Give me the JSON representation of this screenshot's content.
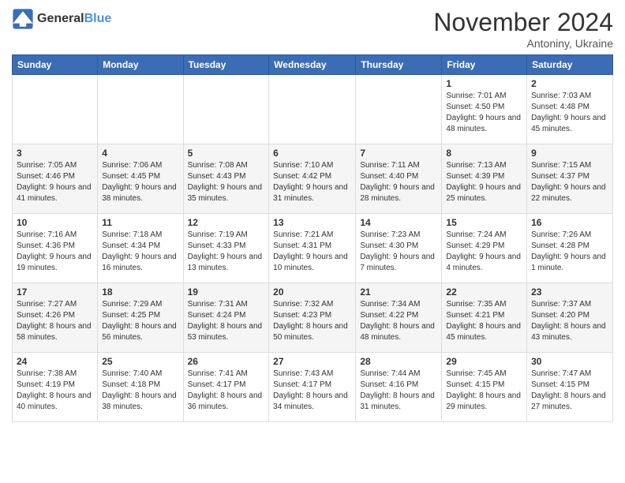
{
  "header": {
    "logo_general": "General",
    "logo_blue": "Blue",
    "month": "November 2024",
    "location": "Antoniny, Ukraine"
  },
  "weekdays": [
    "Sunday",
    "Monday",
    "Tuesday",
    "Wednesday",
    "Thursday",
    "Friday",
    "Saturday"
  ],
  "weeks": [
    [
      {
        "day": "",
        "info": ""
      },
      {
        "day": "",
        "info": ""
      },
      {
        "day": "",
        "info": ""
      },
      {
        "day": "",
        "info": ""
      },
      {
        "day": "",
        "info": ""
      },
      {
        "day": "1",
        "info": "Sunrise: 7:01 AM\nSunset: 4:50 PM\nDaylight: 9 hours and 48 minutes."
      },
      {
        "day": "2",
        "info": "Sunrise: 7:03 AM\nSunset: 4:48 PM\nDaylight: 9 hours and 45 minutes."
      }
    ],
    [
      {
        "day": "3",
        "info": "Sunrise: 7:05 AM\nSunset: 4:46 PM\nDaylight: 9 hours and 41 minutes."
      },
      {
        "day": "4",
        "info": "Sunrise: 7:06 AM\nSunset: 4:45 PM\nDaylight: 9 hours and 38 minutes."
      },
      {
        "day": "5",
        "info": "Sunrise: 7:08 AM\nSunset: 4:43 PM\nDaylight: 9 hours and 35 minutes."
      },
      {
        "day": "6",
        "info": "Sunrise: 7:10 AM\nSunset: 4:42 PM\nDaylight: 9 hours and 31 minutes."
      },
      {
        "day": "7",
        "info": "Sunrise: 7:11 AM\nSunset: 4:40 PM\nDaylight: 9 hours and 28 minutes."
      },
      {
        "day": "8",
        "info": "Sunrise: 7:13 AM\nSunset: 4:39 PM\nDaylight: 9 hours and 25 minutes."
      },
      {
        "day": "9",
        "info": "Sunrise: 7:15 AM\nSunset: 4:37 PM\nDaylight: 9 hours and 22 minutes."
      }
    ],
    [
      {
        "day": "10",
        "info": "Sunrise: 7:16 AM\nSunset: 4:36 PM\nDaylight: 9 hours and 19 minutes."
      },
      {
        "day": "11",
        "info": "Sunrise: 7:18 AM\nSunset: 4:34 PM\nDaylight: 9 hours and 16 minutes."
      },
      {
        "day": "12",
        "info": "Sunrise: 7:19 AM\nSunset: 4:33 PM\nDaylight: 9 hours and 13 minutes."
      },
      {
        "day": "13",
        "info": "Sunrise: 7:21 AM\nSunset: 4:31 PM\nDaylight: 9 hours and 10 minutes."
      },
      {
        "day": "14",
        "info": "Sunrise: 7:23 AM\nSunset: 4:30 PM\nDaylight: 9 hours and 7 minutes."
      },
      {
        "day": "15",
        "info": "Sunrise: 7:24 AM\nSunset: 4:29 PM\nDaylight: 9 hours and 4 minutes."
      },
      {
        "day": "16",
        "info": "Sunrise: 7:26 AM\nSunset: 4:28 PM\nDaylight: 9 hours and 1 minute."
      }
    ],
    [
      {
        "day": "17",
        "info": "Sunrise: 7:27 AM\nSunset: 4:26 PM\nDaylight: 8 hours and 58 minutes."
      },
      {
        "day": "18",
        "info": "Sunrise: 7:29 AM\nSunset: 4:25 PM\nDaylight: 8 hours and 56 minutes."
      },
      {
        "day": "19",
        "info": "Sunrise: 7:31 AM\nSunset: 4:24 PM\nDaylight: 8 hours and 53 minutes."
      },
      {
        "day": "20",
        "info": "Sunrise: 7:32 AM\nSunset: 4:23 PM\nDaylight: 8 hours and 50 minutes."
      },
      {
        "day": "21",
        "info": "Sunrise: 7:34 AM\nSunset: 4:22 PM\nDaylight: 8 hours and 48 minutes."
      },
      {
        "day": "22",
        "info": "Sunrise: 7:35 AM\nSunset: 4:21 PM\nDaylight: 8 hours and 45 minutes."
      },
      {
        "day": "23",
        "info": "Sunrise: 7:37 AM\nSunset: 4:20 PM\nDaylight: 8 hours and 43 minutes."
      }
    ],
    [
      {
        "day": "24",
        "info": "Sunrise: 7:38 AM\nSunset: 4:19 PM\nDaylight: 8 hours and 40 minutes."
      },
      {
        "day": "25",
        "info": "Sunrise: 7:40 AM\nSunset: 4:18 PM\nDaylight: 8 hours and 38 minutes."
      },
      {
        "day": "26",
        "info": "Sunrise: 7:41 AM\nSunset: 4:17 PM\nDaylight: 8 hours and 36 minutes."
      },
      {
        "day": "27",
        "info": "Sunrise: 7:43 AM\nSunset: 4:17 PM\nDaylight: 8 hours and 34 minutes."
      },
      {
        "day": "28",
        "info": "Sunrise: 7:44 AM\nSunset: 4:16 PM\nDaylight: 8 hours and 31 minutes."
      },
      {
        "day": "29",
        "info": "Sunrise: 7:45 AM\nSunset: 4:15 PM\nDaylight: 8 hours and 29 minutes."
      },
      {
        "day": "30",
        "info": "Sunrise: 7:47 AM\nSunset: 4:15 PM\nDaylight: 8 hours and 27 minutes."
      }
    ]
  ]
}
